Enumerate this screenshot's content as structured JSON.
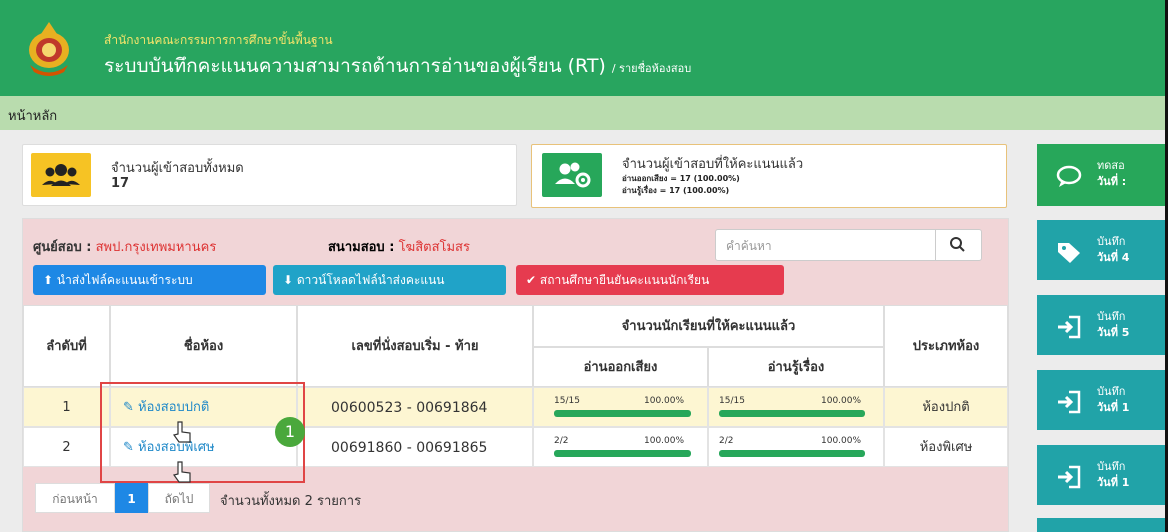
{
  "header": {
    "org": "สำนักงานคณะกรรมการการศึกษาขั้นพื้นฐาน",
    "title": "ระบบบันทึกคะแนนความสามารถด้านการอ่านของผู้เรียน (RT)",
    "subtitle": "/ รายชื่อห้องสอบ"
  },
  "nav": {
    "home": "หน้าหลัก"
  },
  "stats": {
    "total_label": "จำนวนผู้เข้าสอบทั้งหมด",
    "total_value": "17",
    "scored_label": "จำนวนผู้เข้าสอบที่ให้คะแนนแล้ว",
    "scored_line1": "อ่านออกเสียง = 17 (100.00%)",
    "scored_line2": "อ่านรู้เรื่อง = 17 (100.00%)"
  },
  "panel": {
    "center_label": "ศูนย์สอบ :",
    "center_value": "สพป.กรุงเทพมหานคร",
    "venue_label": "สนามสอบ :",
    "venue_value": "โฆสิตสโมสร",
    "search_placeholder": "คำค้นหา",
    "btn_upload": "นำส่งไฟล์คะแนนเข้าระบบ",
    "btn_download": "ดาวน์โหลดไฟล์นำส่งคะแนน",
    "btn_confirm": "สถานศึกษายืนยันคะแนนนักเรียน"
  },
  "table": {
    "h_no": "ลำดับที่",
    "h_room": "ชื่อห้อง",
    "h_seat": "เลขที่นั่งสอบเริ่ม - ท้าย",
    "h_scored": "จำนวนนักเรียนที่ให้คะแนนแล้ว",
    "h_read_aloud": "อ่านออกเสียง",
    "h_read_comp": "อ่านรู้เรื่อง",
    "h_type": "ประเภทห้อง",
    "rows": [
      {
        "no": "1",
        "room": "ห้องสอบปกติ",
        "seat": "00600523 - 00691864",
        "ra_count": "15/15",
        "ra_pct": "100.00%",
        "rc_count": "15/15",
        "rc_pct": "100.00%",
        "type": "ห้องปกติ"
      },
      {
        "no": "2",
        "room": "ห้องสอบพิเศษ",
        "seat": "00691860 - 00691865",
        "ra_count": "2/2",
        "ra_pct": "100.00%",
        "rc_count": "2/2",
        "rc_pct": "100.00%",
        "type": "ห้องพิเศษ"
      }
    ]
  },
  "pager": {
    "prev": "ก่อนหน้า",
    "page": "1",
    "next": "ถัดไป",
    "summary": "จำนวนทั้งหมด 2 รายการ"
  },
  "right": [
    {
      "l1": "ทดสอ",
      "l2": "วันที่ :"
    },
    {
      "l1": "บันทึก",
      "l2": "วันที่ 4"
    },
    {
      "l1": "บันทึก",
      "l2": "วันที่ 5"
    },
    {
      "l1": "บันทึก",
      "l2": "วันที่ 1"
    },
    {
      "l1": "บันทึก",
      "l2": "วันที่ 1"
    }
  ],
  "annotation": {
    "number": "1"
  },
  "colors": {
    "header": "#28a55f",
    "nav": "#b9dcae",
    "panel": "#f1d5d7",
    "accent": "#21a3a8"
  }
}
